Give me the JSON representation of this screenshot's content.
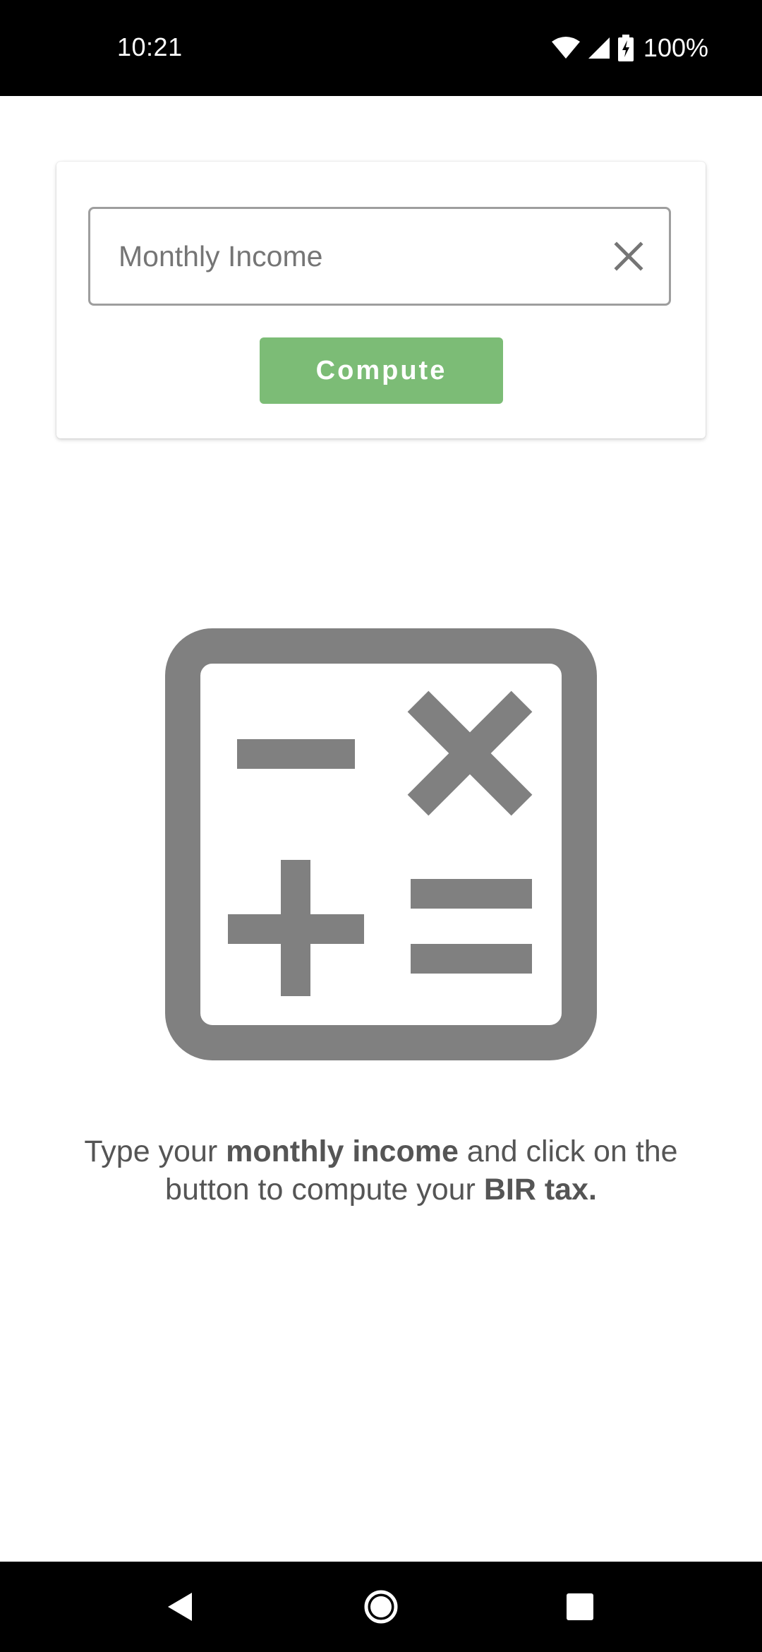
{
  "status_bar": {
    "time": "10:21",
    "battery": "100%",
    "icons": [
      "wifi-icon",
      "signal-icon",
      "battery-charging-icon"
    ]
  },
  "income_form": {
    "input_placeholder": "Monthly Income",
    "input_value": "",
    "clear_icon": "close-icon",
    "compute_label": "Compute"
  },
  "illustration": {
    "icon": "calculator-icon"
  },
  "hint": {
    "part1": "Type your ",
    "bold1": "monthly income",
    "part2": " and click on the button to compute your ",
    "bold2": "BIR tax."
  },
  "nav_bar": {
    "icons": [
      "back-icon",
      "home-icon",
      "recents-icon"
    ]
  },
  "colors": {
    "primary_button": "#7cbc76",
    "icon_gray": "#808080",
    "text_gray": "#555555"
  }
}
